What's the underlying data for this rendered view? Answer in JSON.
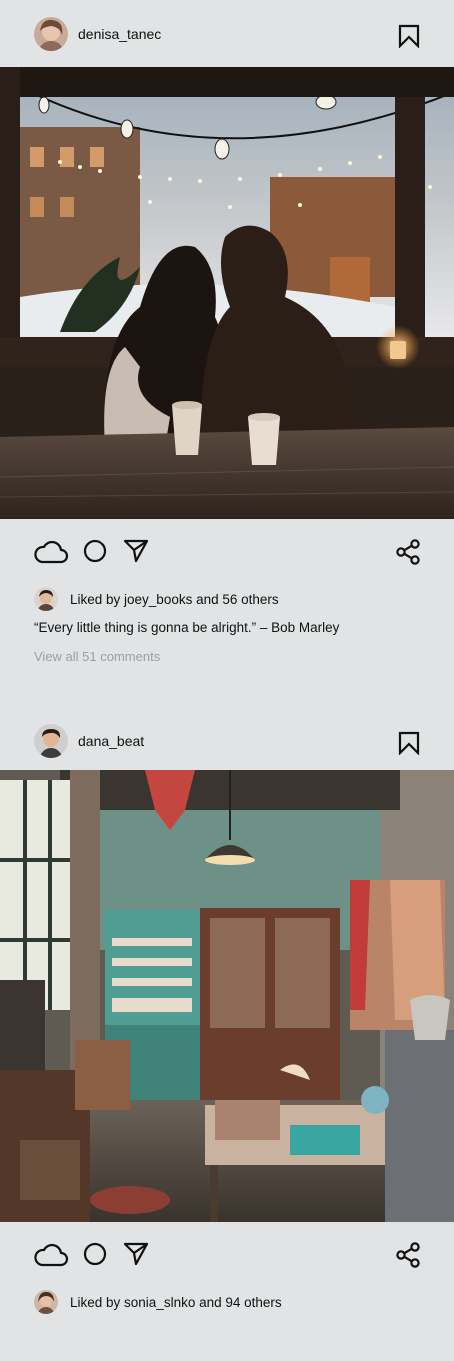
{
  "posts": [
    {
      "username": "denisa_tanec",
      "likes_text": "Liked by joey_books and 56 others",
      "caption": "“Every little thing is gonna be alright.” – Bob Marley",
      "view_comments": "View all 51 comments"
    },
    {
      "username": "dana_beat",
      "likes_text": "Liked by sonia_slnko and 94 others"
    }
  ],
  "icons": {
    "bookmark": "bookmark-icon",
    "like": "cloud-icon",
    "comment": "circle-icon",
    "send": "send-icon",
    "share": "share-icon"
  }
}
